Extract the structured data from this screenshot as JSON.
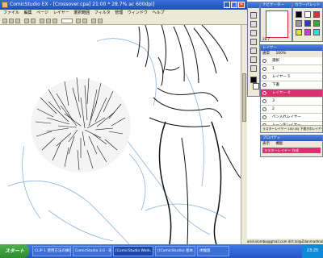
{
  "window": {
    "title": "ComicStudio EX - [Crossover.cpa] 21:00 * 28.7% ac 600dpi]",
    "controls": [
      "_",
      "□",
      "×"
    ]
  },
  "menu": [
    "ファイル",
    "編集",
    "ページ",
    "レイヤー",
    "選択範囲",
    "フィルタ",
    "管理",
    "ウィンドウ",
    "ヘルプ"
  ],
  "navigator": {
    "title": "ナビゲーター",
    "zoom": "28.7"
  },
  "colors_panel": {
    "title": "カラーパレット"
  },
  "layers_panel": {
    "title": "レイヤー",
    "mode": "通常",
    "opacity": "100%",
    "items": [
      {
        "name": "選択",
        "selected": false
      },
      {
        "name": "1",
        "selected": false
      },
      {
        "name": "レイヤー 5",
        "selected": false
      },
      {
        "name": "下書",
        "selected": false
      },
      {
        "name": "レイヤー 4",
        "selected": true
      },
      {
        "name": "3",
        "selected": false
      },
      {
        "name": "2",
        "selected": false
      },
      {
        "name": "ペン入れレイヤー",
        "selected": false
      },
      {
        "name": "トーン化レイヤー",
        "selected": false
      },
      {
        "name": "ブラシレイヤー",
        "selected": false
      }
    ],
    "footer": "ラスターレイヤー 100 (8) 下書きのレイヤーの"
  },
  "properties_panel": {
    "title": "プロパティ",
    "tabs": [
      "表示",
      "機能"
    ],
    "selected_item": "ラスターレイヤー 作成"
  },
  "status": "ariel.slomba@gmail.com   dirt.lol@Zdanmadmail.com",
  "taskbar": {
    "start": "スタート",
    "tasks": [
      {
        "label": "CLIP 1 使用方法の練習",
        "active": false
      },
      {
        "label": "ComicStudio 3.0 - Bu...",
        "active": false
      },
      {
        "label": "[ComicStudio Work...",
        "active": true
      },
      {
        "label": "[(ComicStudio) 基本...",
        "active": false
      },
      {
        "label": "体験版",
        "active": false
      }
    ],
    "clock": "23:25"
  },
  "icons": [
    "app-icon",
    "eye-icon",
    "lock-icon",
    "layer-icon",
    "pen-tool-icon",
    "brush-tool-icon",
    "eraser-icon",
    "zoom-icon",
    "hand-icon",
    "start-windows-icon"
  ]
}
